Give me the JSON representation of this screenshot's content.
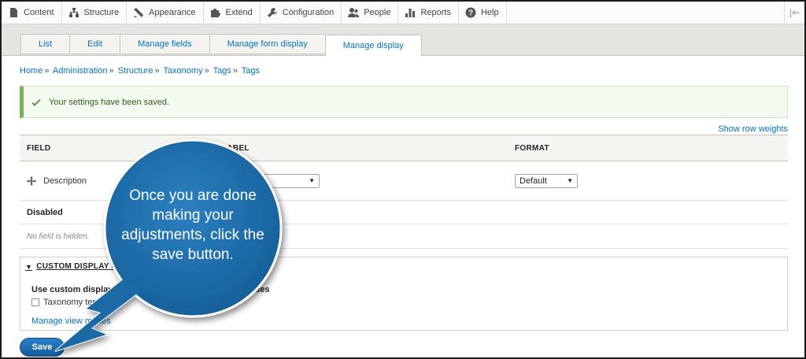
{
  "toolbar": {
    "items": [
      {
        "label": "Content",
        "icon": "content-icon"
      },
      {
        "label": "Structure",
        "icon": "structure-icon"
      },
      {
        "label": "Appearance",
        "icon": "appearance-icon"
      },
      {
        "label": "Extend",
        "icon": "extend-icon"
      },
      {
        "label": "Configuration",
        "icon": "wrench-icon"
      },
      {
        "label": "People",
        "icon": "people-icon"
      },
      {
        "label": "Reports",
        "icon": "reports-icon"
      },
      {
        "label": "Help",
        "icon": "help-icon"
      }
    ],
    "toggle_icon": "orientation-toggle-icon"
  },
  "tabs": [
    {
      "label": "List"
    },
    {
      "label": "Edit"
    },
    {
      "label": "Manage fields"
    },
    {
      "label": "Manage form display"
    },
    {
      "label": "Manage display",
      "active": true
    }
  ],
  "breadcrumb": [
    "Home",
    "Administration",
    "Structure",
    "Taxonomy",
    "Tags",
    "Tags"
  ],
  "breadcrumb_separator": "»",
  "status": {
    "message": "Your settings have been saved.",
    "color": "#77b259"
  },
  "row_weights_link": "Show row weights",
  "table": {
    "headers": {
      "field": "FIELD",
      "label": "LABEL",
      "format": "FORMAT"
    },
    "rows": [
      {
        "field": "Description",
        "label_select": "- Hidden -",
        "format_select": "Default"
      }
    ],
    "disabled_region": "Disabled",
    "no_hidden": "No field is hidden."
  },
  "custom_display": {
    "summary": "CUSTOM DISPLAY SETTINGS",
    "heading": "Use custom display settings for the following view modes",
    "checkbox_label": "Taxonomy term page",
    "manage_link": "Manage view modes"
  },
  "save_button": "Save",
  "callout": {
    "text": "Once you are done making your adjustments, click the save button.",
    "color": "#1b6aa5"
  },
  "accent_color": "#0074bd"
}
